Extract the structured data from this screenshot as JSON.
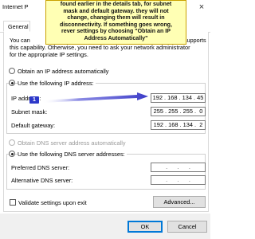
{
  "window": {
    "title": "Internet P",
    "close_glyph": "×"
  },
  "tabs": [
    {
      "label": "General"
    }
  ],
  "callout": {
    "lines": [
      "found earlier in the details tab, for subnet",
      "mask and default gateway. they will not",
      "change, changing them will result in",
      "disconnectivity. If something goes wrong,",
      "rever settings by choosing \"Obtain an IP",
      "Address Automatically\""
    ],
    "badge": "1"
  },
  "description": {
    "line1_left": "You can",
    "line1_right": "supports",
    "line2": "this capability. Otherwise, you need to ask your network administrator",
    "line3": "for the appropriate IP settings."
  },
  "ip": {
    "auto_label": "Obtain an IP address automatically",
    "manual_label": "Use the following IP address:",
    "fields": [
      {
        "label": "IP address:",
        "value": "192 . 168 . 134 . 45"
      },
      {
        "label": "Subnet mask:",
        "value": "255 . 255 . 255 .  0"
      },
      {
        "label": "Default gateway:",
        "value": "192 . 168 . 134 .  2"
      }
    ]
  },
  "dns": {
    "auto_label": "Obtain DNS server address automatically",
    "manual_label": "Use the following DNS server addresses:",
    "fields": [
      {
        "label": "Preferred DNS server:",
        "value": "  .      .      .  "
      },
      {
        "label": "Alternative DNS server:",
        "value": "  .      .      .  "
      }
    ]
  },
  "validate_label": "Validate settings upon exit",
  "buttons": {
    "advanced": "Advanced...",
    "ok": "OK",
    "cancel": "Cancel"
  },
  "colors": {
    "callout_bg": "#ffffb4",
    "callout_border": "#c9a100",
    "arrow": "#3c3cc8",
    "badge_bg": "#2d38c9",
    "primary_border": "#0078d7"
  },
  "icons": {
    "close": "close-icon",
    "arrow": "arrow-annotation"
  }
}
